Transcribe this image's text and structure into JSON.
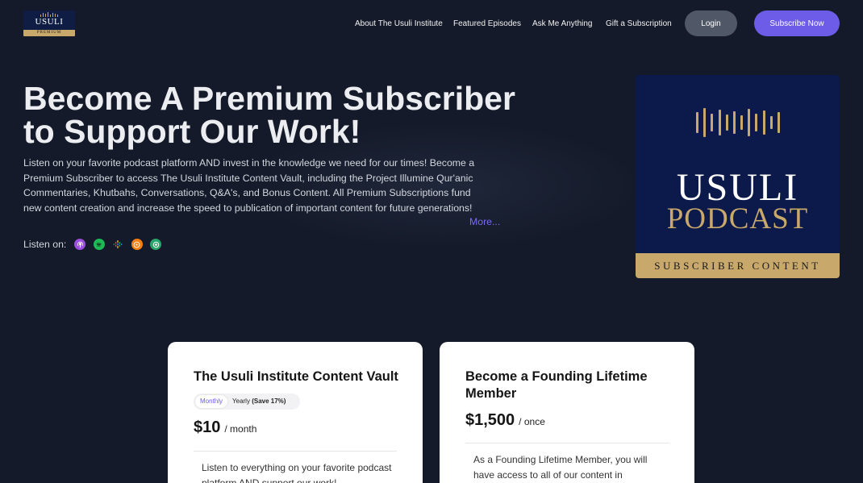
{
  "brand": {
    "logo_word": "USULI",
    "logo_band": "PREMIUM",
    "gold": "#c9a86b",
    "navy": "#0b1a4a",
    "accent": "#6c5ce7"
  },
  "nav": {
    "links": [
      "About The Usuli Institute",
      "Featured Episodes",
      "Ask Me Anything",
      "Gift a Subscription"
    ],
    "login_label": "Login",
    "subscribe_label": "Subscribe Now"
  },
  "hero": {
    "title_line1": "Become A Premium Subscriber",
    "title_line2": "to Support Our Work!",
    "description": "Listen on your favorite podcast platform AND invest in the knowledge we need for our times! Become a Premium Subscriber to access The Usuli Institute Content Vault, including the Project Illumine Qur'anic Commentaries, Khutbahs, Conversations, Q&A's, and Bonus Content. All Premium Subscriptions fund new content creation and increase the speed to publication of important content for future generations!",
    "more_label": "More...",
    "listen_label": "Listen on:",
    "platforms": [
      {
        "icon": "apple-podcasts-icon",
        "color": "#9b4ee0"
      },
      {
        "icon": "spotify-icon",
        "color": "#1db954"
      },
      {
        "icon": "google-podcasts-icon",
        "color": "#4285f4"
      },
      {
        "icon": "overcast-icon",
        "color": "#fc7e0f"
      },
      {
        "icon": "pocket-casts-icon",
        "color": "#2ba36b"
      }
    ]
  },
  "cover": {
    "word1": "USULI",
    "word2": "PODCAST",
    "band": "SUBSCRIBER CONTENT"
  },
  "cards": [
    {
      "title": "The Usuli Institute Content Vault",
      "toggle_monthly": "Monthly",
      "toggle_yearly": "Yearly",
      "toggle_yearly_save": "(Save 17%)",
      "price": "$10",
      "price_unit": "/ month",
      "text": "Listen to everything on your favorite podcast platform AND support our work!"
    },
    {
      "title": "Become a Founding Lifetime Member",
      "price": "$1,500",
      "price_unit": "/ once",
      "text": "As a Founding Lifetime Member, you will have access to all of our content in perpetuity,"
    }
  ]
}
